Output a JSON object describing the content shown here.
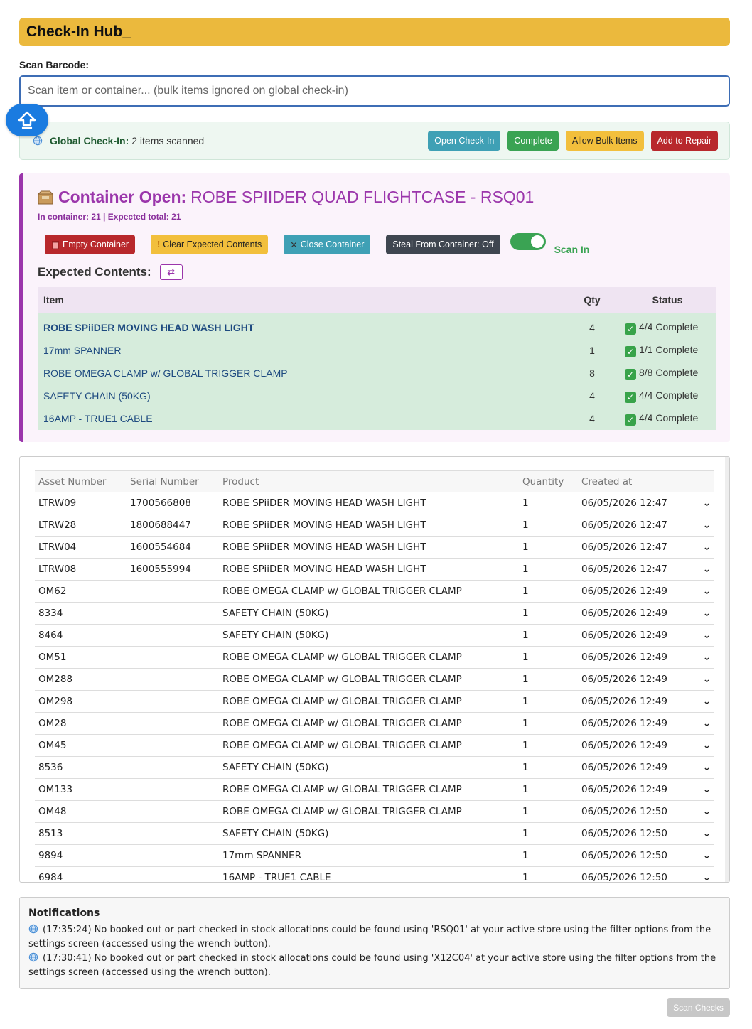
{
  "header": {
    "title": "Check-In Hub_"
  },
  "scan": {
    "label": "Scan Barcode:",
    "placeholder": "Scan item or container... (bulk items ignored on global check-in)"
  },
  "global": {
    "label": "Global Check-In:",
    "count_text": "2 items scanned",
    "buttons": {
      "open": "Open Check-In",
      "complete": "Complete",
      "allow_bulk": "Allow Bulk Items",
      "repair": "Add to Repair"
    }
  },
  "container": {
    "title_prefix": "Container Open:",
    "title_name": "ROBE SPIIDER QUAD FLIGHTCASE - RSQ01",
    "summary": "In container: 21 | Expected total: 21",
    "buttons": {
      "empty": "Empty Container",
      "clear": "Clear Expected Contents",
      "close": "Close Container",
      "steal": "Steal From Container: Off"
    },
    "toggle_on": true,
    "toggle_label": "Scan In",
    "expected_label": "Expected Contents:",
    "columns": {
      "item": "Item",
      "qty": "Qty",
      "status": "Status"
    },
    "rows": [
      {
        "item": "ROBE SPiiDER MOVING HEAD WASH LIGHT",
        "qty": "4",
        "status": "4/4 Complete"
      },
      {
        "item": "17mm SPANNER",
        "qty": "1",
        "status": "1/1 Complete"
      },
      {
        "item": "ROBE OMEGA CLAMP w/ GLOBAL TRIGGER CLAMP",
        "qty": "8",
        "status": "8/8 Complete"
      },
      {
        "item": "SAFETY CHAIN (50KG)",
        "qty": "4",
        "status": "4/4 Complete"
      },
      {
        "item": "16AMP - TRUE1 CABLE",
        "qty": "4",
        "status": "4/4 Complete"
      }
    ]
  },
  "assets": {
    "columns": {
      "asset": "Asset Number",
      "serial": "Serial Number",
      "product": "Product",
      "quantity": "Quantity",
      "created": "Created at"
    },
    "rows": [
      {
        "asset": "LTRW09",
        "serial": "1700566808",
        "product": "ROBE SPiiDER MOVING HEAD WASH LIGHT",
        "quantity": "1",
        "created": "06/05/2026 12:47"
      },
      {
        "asset": "LTRW28",
        "serial": "1800688447",
        "product": "ROBE SPiiDER MOVING HEAD WASH LIGHT",
        "quantity": "1",
        "created": "06/05/2026 12:47"
      },
      {
        "asset": "LTRW04",
        "serial": "1600554684",
        "product": "ROBE SPiiDER MOVING HEAD WASH LIGHT",
        "quantity": "1",
        "created": "06/05/2026 12:47"
      },
      {
        "asset": "LTRW08",
        "serial": "1600555994",
        "product": "ROBE SPiiDER MOVING HEAD WASH LIGHT",
        "quantity": "1",
        "created": "06/05/2026 12:47"
      },
      {
        "asset": "OM62",
        "serial": "",
        "product": "ROBE OMEGA CLAMP w/ GLOBAL TRIGGER CLAMP",
        "quantity": "1",
        "created": "06/05/2026 12:49"
      },
      {
        "asset": "8334",
        "serial": "",
        "product": "SAFETY CHAIN (50KG)",
        "quantity": "1",
        "created": "06/05/2026 12:49"
      },
      {
        "asset": "8464",
        "serial": "",
        "product": "SAFETY CHAIN (50KG)",
        "quantity": "1",
        "created": "06/05/2026 12:49"
      },
      {
        "asset": "OM51",
        "serial": "",
        "product": "ROBE OMEGA CLAMP w/ GLOBAL TRIGGER CLAMP",
        "quantity": "1",
        "created": "06/05/2026 12:49"
      },
      {
        "asset": "OM288",
        "serial": "",
        "product": "ROBE OMEGA CLAMP w/ GLOBAL TRIGGER CLAMP",
        "quantity": "1",
        "created": "06/05/2026 12:49"
      },
      {
        "asset": "OM298",
        "serial": "",
        "product": "ROBE OMEGA CLAMP w/ GLOBAL TRIGGER CLAMP",
        "quantity": "1",
        "created": "06/05/2026 12:49"
      },
      {
        "asset": "OM28",
        "serial": "",
        "product": "ROBE OMEGA CLAMP w/ GLOBAL TRIGGER CLAMP",
        "quantity": "1",
        "created": "06/05/2026 12:49"
      },
      {
        "asset": "OM45",
        "serial": "",
        "product": "ROBE OMEGA CLAMP w/ GLOBAL TRIGGER CLAMP",
        "quantity": "1",
        "created": "06/05/2026 12:49"
      },
      {
        "asset": "8536",
        "serial": "",
        "product": "SAFETY CHAIN (50KG)",
        "quantity": "1",
        "created": "06/05/2026 12:49"
      },
      {
        "asset": "OM133",
        "serial": "",
        "product": "ROBE OMEGA CLAMP w/ GLOBAL TRIGGER CLAMP",
        "quantity": "1",
        "created": "06/05/2026 12:49"
      },
      {
        "asset": "OM48",
        "serial": "",
        "product": "ROBE OMEGA CLAMP w/ GLOBAL TRIGGER CLAMP",
        "quantity": "1",
        "created": "06/05/2026 12:50"
      },
      {
        "asset": "8513",
        "serial": "",
        "product": "SAFETY CHAIN (50KG)",
        "quantity": "1",
        "created": "06/05/2026 12:50"
      },
      {
        "asset": "9894",
        "serial": "",
        "product": "17mm SPANNER",
        "quantity": "1",
        "created": "06/05/2026 12:50"
      },
      {
        "asset": "6984",
        "serial": "",
        "product": "16AMP - TRUE1 CABLE",
        "quantity": "1",
        "created": "06/05/2026 12:50"
      }
    ]
  },
  "notifications": {
    "title": "Notifications",
    "items": [
      "(17:35:24) No booked out or part checked in stock allocations could be found using 'RSQ01' at your active store using the filter options from the settings screen (accessed using the wrench button).",
      "(17:30:41) No booked out or part checked in stock allocations could be found using 'X12C04' at your active store using the filter options from the settings screen (accessed using the wrench button)."
    ]
  },
  "footer": {
    "scan_checks": "Scan Checks"
  },
  "colors": {
    "header": "#ebb93d",
    "accent_purple": "#9b36ab",
    "success": "#3aa353",
    "danger": "#b8282c",
    "info": "#3fa0b5",
    "primary": "#1a7be0"
  }
}
